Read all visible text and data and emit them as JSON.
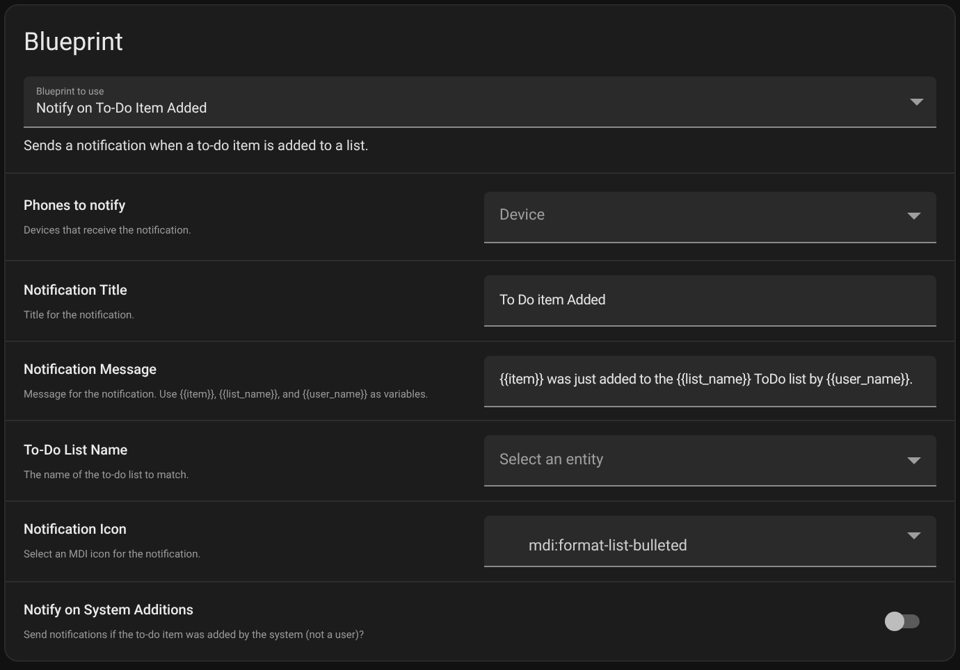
{
  "title": "Blueprint",
  "blueprint": {
    "label": "Blueprint to use",
    "value": "Notify on To-Do Item Added",
    "description": "Sends a notification when a to-do item is added to a list."
  },
  "inputs": [
    {
      "name": "Phones to notify",
      "description": "Devices that receive the notification.",
      "kind": "select",
      "placeholder": "Device"
    },
    {
      "name": "Notification Title",
      "description": "Title for the notification.",
      "kind": "text",
      "value": "To Do item Added"
    },
    {
      "name": "Notification Message",
      "description": "Message for the notification. Use {{item}}, {{list_name}}, and {{user_name}} as variables.",
      "kind": "text",
      "value": "{{item}} was just added to the {{list_name}} ToDo list by {{user_name}}."
    },
    {
      "name": "To-Do List Name",
      "description": "The name of the to-do list to match.",
      "kind": "select",
      "placeholder": "Select an entity"
    },
    {
      "name": "Notification Icon",
      "description": "Select an MDI icon for the notification.",
      "kind": "icon",
      "value": "mdi:format-list-bulleted"
    },
    {
      "name": "Notify on System Additions",
      "description": "Send notifications if the to-do item was added by the system (not a user)?",
      "kind": "toggle",
      "on": false
    }
  ]
}
